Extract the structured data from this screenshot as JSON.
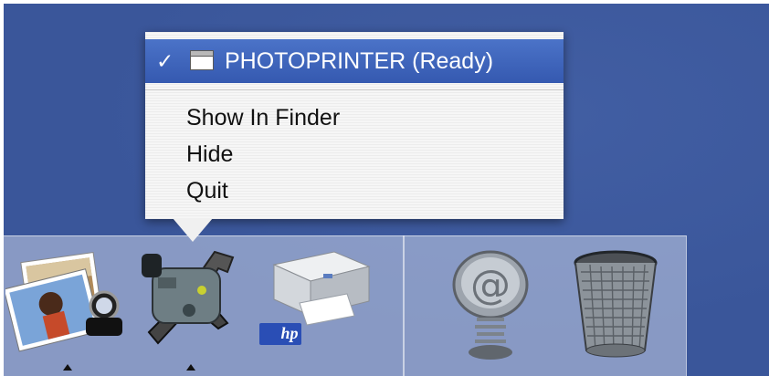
{
  "menu": {
    "selected_item": {
      "label": "PHOTOPRINTER (Ready)",
      "check_glyph": "✓",
      "icon": "window-icon"
    },
    "items": [
      {
        "label": "Show In Finder"
      },
      {
        "label": "Hide"
      },
      {
        "label": "Quit"
      }
    ]
  },
  "dock": {
    "apps": [
      {
        "name": "iphoto",
        "icon": "photo-album-icon",
        "running": true
      },
      {
        "name": "printer-utility",
        "icon": "printer-utility-icon",
        "running": true
      },
      {
        "name": "hp-printer",
        "icon": "hp-printer-icon",
        "running": false,
        "badge": "hp"
      }
    ],
    "others": [
      {
        "name": "mail",
        "icon": "at-sign-spring-icon"
      },
      {
        "name": "trash",
        "icon": "trash-can-icon"
      }
    ]
  },
  "colors": {
    "desktop": "#3a569a",
    "highlight": "#4064bc",
    "menu_bg": "#f0f0f0"
  }
}
